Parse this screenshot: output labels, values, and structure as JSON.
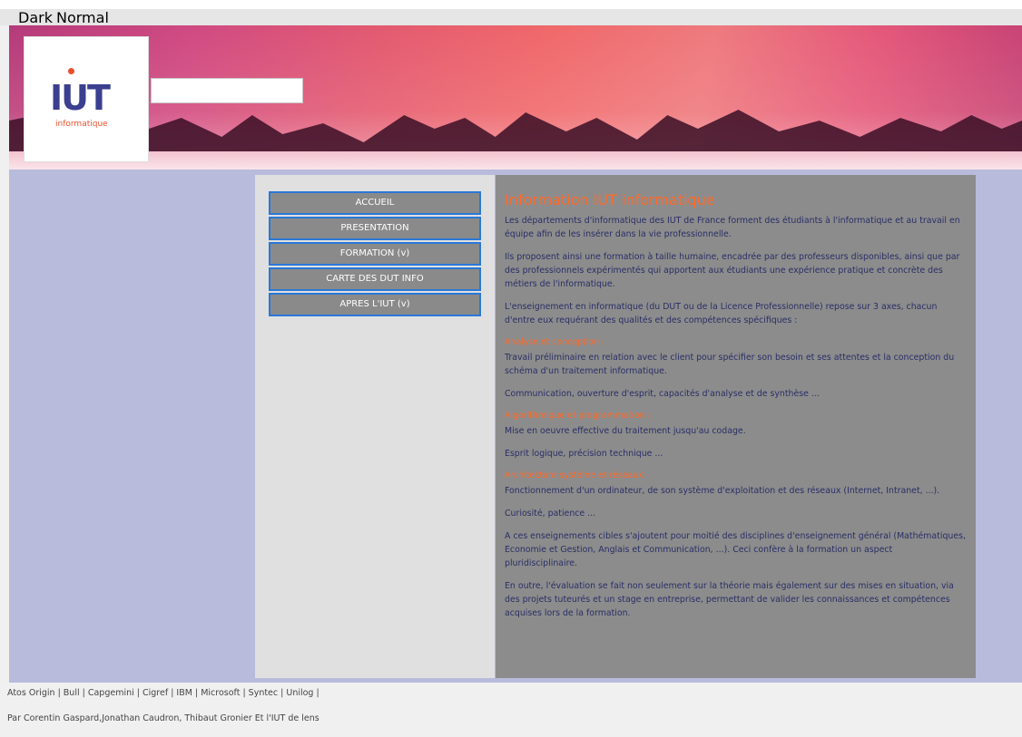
{
  "theme_switch": {
    "dark": "Dark",
    "normal": "Normal"
  },
  "logo": {
    "mark": "IUT",
    "subtitle": "informatique"
  },
  "search": {
    "value": ""
  },
  "nav": [
    {
      "label": "ACCUEIL"
    },
    {
      "label": "PRESENTATION"
    },
    {
      "label": "FORMATION (v)"
    },
    {
      "label": "CARTE DES DUT INFO"
    },
    {
      "label": "APRES L'IUT (v)"
    }
  ],
  "content": {
    "title": "Information IUT informatique",
    "p1": "Les départements d'informatique des IUT de France forment des étudiants à l'informatique et au travail en équipe afin de les insérer dans la vie professionnelle.",
    "p2": "Ils proposent ainsi une formation à taille humaine, encadrée par des professeurs disponibles, ainsi que par des professionnels expérimentés qui apportent aux étudiants une expérience pratique et concrète des métiers de l'informatique.",
    "p3": "L'enseignement en informatique (du DUT ou de la Licence Professionnelle) repose sur 3 axes, chacun d'entre eux requérant des qualités et des compétences spécifiques :",
    "s1_title": "Analyse et conception :",
    "s1_p1": "Travail préliminaire en relation avec le client pour spécifier son besoin et ses attentes et la conception du schéma d'un traitement informatique.",
    "s1_p2": "Communication, ouverture d'esprit, capacités d'analyse et de synthèse ...",
    "s2_title": "Algorithmique et programmation :",
    "s2_p1": "Mise en oeuvre effective du traitement jusqu'au codage.",
    "s2_p2": "Esprit logique, précision technique ...",
    "s3_title": "Architecture système et réseaux :",
    "s3_p1": "Fonctionnement d'un ordinateur, de son système d'exploitation et des réseaux (Internet, Intranet, ...).",
    "s3_p2": "Curiosité, patience ...",
    "p4": "A ces enseignements cibles s'ajoutent pour moitié des disciplines d'enseignement général (Mathématiques, Economie et Gestion, Anglais et Communication, ...). Ceci confère à la formation un aspect pluridisciplinaire.",
    "p5": "En outre, l'évaluation se fait non seulement sur la théorie mais également sur des mises en situation, via des projets tuteurés et un stage en entreprise, permettant de valider les connaissances et compétences acquises lors de la formation."
  },
  "footer": {
    "partners": "Atos Origin | Bull | Capgemini | Cigref | IBM | Microsoft | Syntec | Unilog |",
    "credits": "Par Corentin Gaspard,Jonathan Caudron, Thibaut Gronier Et l'IUT de lens"
  },
  "colors": {
    "accent": "#ff6a2a",
    "nav_border": "#2a78d8",
    "main_bg": "#b8bbdc",
    "content_bg": "#8c8c8c",
    "text": "#2a2f66"
  }
}
